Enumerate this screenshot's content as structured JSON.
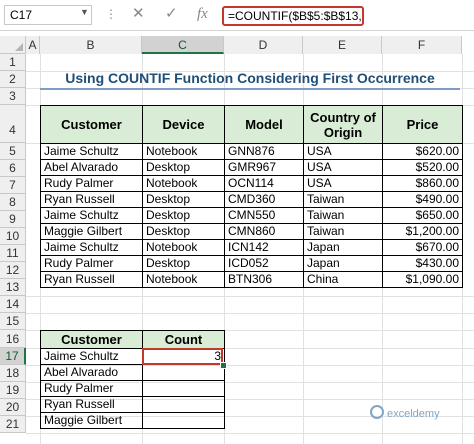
{
  "formula_bar": {
    "name_box": "C17",
    "formula": "=COUNTIF($B$5:$B$13,B17)",
    "cancel_icon": "✕",
    "enter_icon": "✓",
    "fx_label": "fx"
  },
  "columns": [
    "A",
    "B",
    "C",
    "D",
    "E",
    "F"
  ],
  "rows": [
    "1",
    "2",
    "3",
    "4",
    "5",
    "6",
    "7",
    "8",
    "9",
    "10",
    "11",
    "12",
    "13",
    "14",
    "15",
    "16",
    "17",
    "18",
    "19",
    "20",
    "21"
  ],
  "title": "Using COUNTIF Function Considering First Occurrence",
  "main_table": {
    "headers": [
      "Customer",
      "Device",
      "Model",
      "Country of Origin",
      "Price"
    ],
    "rows": [
      [
        "Jaime Schultz",
        "Notebook",
        "GNN876",
        "USA",
        "$620.00"
      ],
      [
        "Abel Alvarado",
        "Desktop",
        "GMR967",
        "USA",
        "$520.00"
      ],
      [
        "Rudy Palmer",
        "Notebook",
        "OCN114",
        "USA",
        "$860.00"
      ],
      [
        "Ryan Russell",
        "Desktop",
        "CMD360",
        "Taiwan",
        "$490.00"
      ],
      [
        "Jaime Schultz",
        "Desktop",
        "CMN550",
        "Taiwan",
        "$650.00"
      ],
      [
        "Maggie Gilbert",
        "Desktop",
        "CMN860",
        "Taiwan",
        "$1,200.00"
      ],
      [
        "Jaime Schultz",
        "Notebook",
        "ICN142",
        "Japan",
        "$670.00"
      ],
      [
        "Rudy Palmer",
        "Desktop",
        "ICD052",
        "Japan",
        "$430.00"
      ],
      [
        "Ryan Russell",
        "Notebook",
        "BTN306",
        "China",
        "$1,090.00"
      ]
    ]
  },
  "count_table": {
    "headers": [
      "Customer",
      "Count"
    ],
    "rows": [
      [
        "Jaime Schultz",
        "3"
      ],
      [
        "Abel Alvarado",
        ""
      ],
      [
        "Rudy Palmer",
        ""
      ],
      [
        "Ryan Russell",
        ""
      ],
      [
        "Maggie Gilbert",
        ""
      ]
    ]
  },
  "watermark": "exceldemy"
}
